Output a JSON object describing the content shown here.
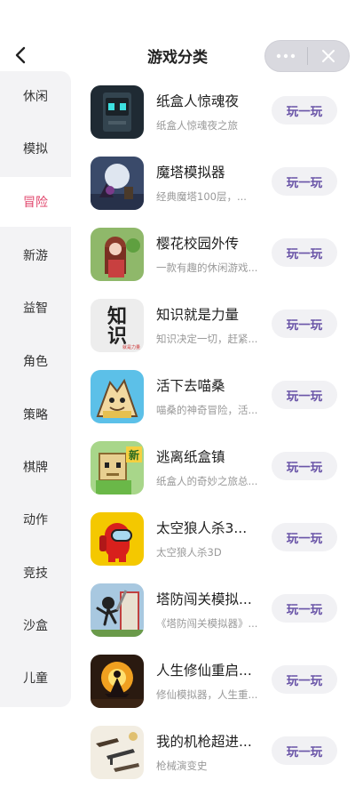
{
  "header": {
    "title": "游戏分类"
  },
  "sidebar": {
    "items": [
      {
        "label": "休闲",
        "active": false
      },
      {
        "label": "模拟",
        "active": false
      },
      {
        "label": "冒险",
        "active": true
      },
      {
        "label": "新游",
        "active": false
      },
      {
        "label": "益智",
        "active": false
      },
      {
        "label": "角色",
        "active": false
      },
      {
        "label": "策略",
        "active": false
      },
      {
        "label": "棋牌",
        "active": false
      },
      {
        "label": "动作",
        "active": false
      },
      {
        "label": "竞技",
        "active": false
      },
      {
        "label": "沙盒",
        "active": false
      },
      {
        "label": "儿童",
        "active": false
      }
    ]
  },
  "games": [
    {
      "name": "纸盒人惊魂夜",
      "desc": "纸盒人惊魂夜之旅",
      "action": "玩一玩"
    },
    {
      "name": "魔塔模拟器",
      "desc": "经典魔塔100层，...",
      "action": "玩一玩"
    },
    {
      "name": "樱花校园外传",
      "desc": "一款有趣的休闲游戏...",
      "action": "玩一玩"
    },
    {
      "name": "知识就是力量",
      "desc": "知识决定一切，赶紧...",
      "action": "玩一玩"
    },
    {
      "name": "活下去喵桑",
      "desc": "喵桑的神奇冒险，活...",
      "action": "玩一玩"
    },
    {
      "name": "逃离纸盒镇",
      "desc": "纸盒人的奇妙之旅总...",
      "action": "玩一玩"
    },
    {
      "name": "太空狼人杀3...",
      "desc": "太空狼人杀3D",
      "action": "玩一玩"
    },
    {
      "name": "塔防闯关模拟...",
      "desc": "《塔防闯关模拟器》...",
      "action": "玩一玩"
    },
    {
      "name": "人生修仙重启...",
      "desc": "修仙模拟器，人生重...",
      "action": "玩一玩"
    },
    {
      "name": "我的机枪超进...",
      "desc": "枪械演变史",
      "action": "玩一玩"
    }
  ],
  "thumb_text": {
    "zhishi_top": "知",
    "zhishi_bottom": "识",
    "zhishi_tag": "就是力量",
    "taofang_sign": "新"
  },
  "colors": {
    "active": "#e0436a",
    "play_text": "#6a55a8",
    "sidebar_bg": "#f3f3f5"
  }
}
